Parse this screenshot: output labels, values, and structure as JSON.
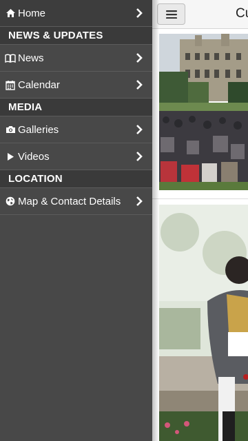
{
  "sidebar": {
    "home": {
      "label": "Home",
      "icon": "home-icon"
    },
    "sections": [
      {
        "title": "NEWS & UPDATES"
      },
      {
        "title": "MEDIA"
      },
      {
        "title": "LOCATION"
      }
    ],
    "items": [
      {
        "label": "News",
        "icon": "book-icon"
      },
      {
        "label": "Calendar",
        "icon": "calendar-icon"
      },
      {
        "label": "Galleries",
        "icon": "camera-icon"
      },
      {
        "label": "Videos",
        "icon": "play-icon"
      },
      {
        "label": "Map & Contact Details",
        "icon": "globe-icon"
      }
    ]
  },
  "main": {
    "title": "Cu",
    "menu_icon": "hamburger-icon"
  },
  "colors": {
    "sidebar_bg": "#484848",
    "header_bg": "#3a3a3a",
    "text": "#ffffff"
  }
}
